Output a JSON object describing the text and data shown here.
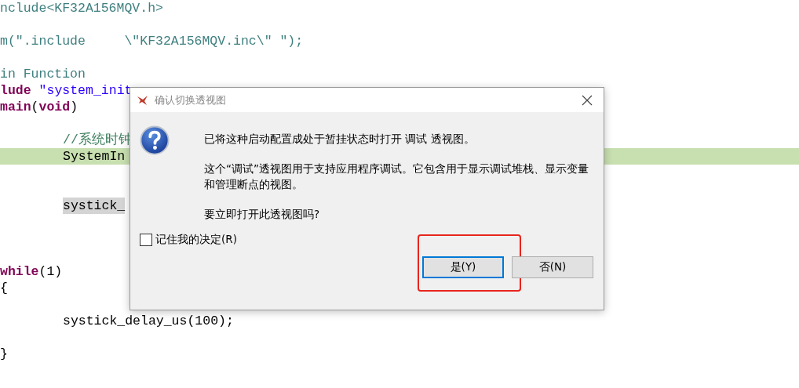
{
  "editor": {
    "lines": [
      {
        "kind": "code",
        "tokens": [
          {
            "kind": "directive",
            "text": "nclude<KF32A156MQV.h>"
          }
        ]
      },
      {
        "kind": "blank"
      },
      {
        "kind": "code",
        "tokens": [
          {
            "kind": "directive",
            "text": "m(\".include     \\\"KF32A156MQV.inc\\\" \");"
          }
        ]
      },
      {
        "kind": "blank"
      },
      {
        "kind": "code",
        "tokens": [
          {
            "kind": "directive",
            "text": "in Function"
          }
        ]
      },
      {
        "kind": "code",
        "tokens": [
          {
            "kind": "keyword",
            "text": "lude"
          },
          {
            "kind": "string",
            "text": "\"system_init"
          }
        ]
      },
      {
        "kind": "code",
        "tokens": [
          {
            "kind": "keyword",
            "text": "main"
          },
          {
            "kind": "plain",
            "text": "("
          },
          {
            "kind": "keyword",
            "text": "void"
          },
          {
            "kind": "plain",
            "text": ")"
          }
        ]
      },
      {
        "kind": "blank"
      },
      {
        "kind": "code",
        "indented": true,
        "tokens": [
          {
            "kind": "comment",
            "text": "//系统时钟"
          }
        ]
      },
      {
        "kind": "code",
        "indented": true,
        "current_line": true,
        "tokens": [
          {
            "kind": "plain",
            "text": "SystemIn"
          }
        ]
      },
      {
        "kind": "blank"
      },
      {
        "kind": "blank"
      },
      {
        "kind": "code",
        "indented": true,
        "occurrence": true,
        "tokens": [
          {
            "kind": "plain",
            "text": "systick_"
          }
        ]
      },
      {
        "kind": "blank"
      },
      {
        "kind": "blank"
      },
      {
        "kind": "blank"
      },
      {
        "kind": "code",
        "tokens": [
          {
            "kind": "keyword",
            "text": "while"
          },
          {
            "kind": "plain",
            "text": "(1)"
          }
        ]
      },
      {
        "kind": "code",
        "tokens": [
          {
            "kind": "plain",
            "text": "{"
          }
        ]
      },
      {
        "kind": "blank"
      },
      {
        "kind": "code",
        "indented": true,
        "tokens": [
          {
            "kind": "plain",
            "text": "systick_delay_us(100);"
          }
        ]
      },
      {
        "kind": "blank"
      },
      {
        "kind": "code",
        "tokens": [
          {
            "kind": "plain",
            "text": "}"
          }
        ]
      }
    ]
  },
  "dialog": {
    "title": "确认切换透视图",
    "messages": [
      "已将这种启动配置成处于暂挂状态时打开 调试 透视图。",
      "这个“调试”透视图用于支持应用程序调试。它包含用于显示调试堆栈、显示变量和管理断点的视图。",
      "要立即打开此透视图吗?"
    ],
    "checkbox": {
      "label": "记住我的决定(R)",
      "checked": false
    },
    "buttons": [
      {
        "label": "是(Y)",
        "selected": true,
        "marked": true
      },
      {
        "label": "否(N)",
        "selected": false,
        "marked": false
      }
    ]
  }
}
